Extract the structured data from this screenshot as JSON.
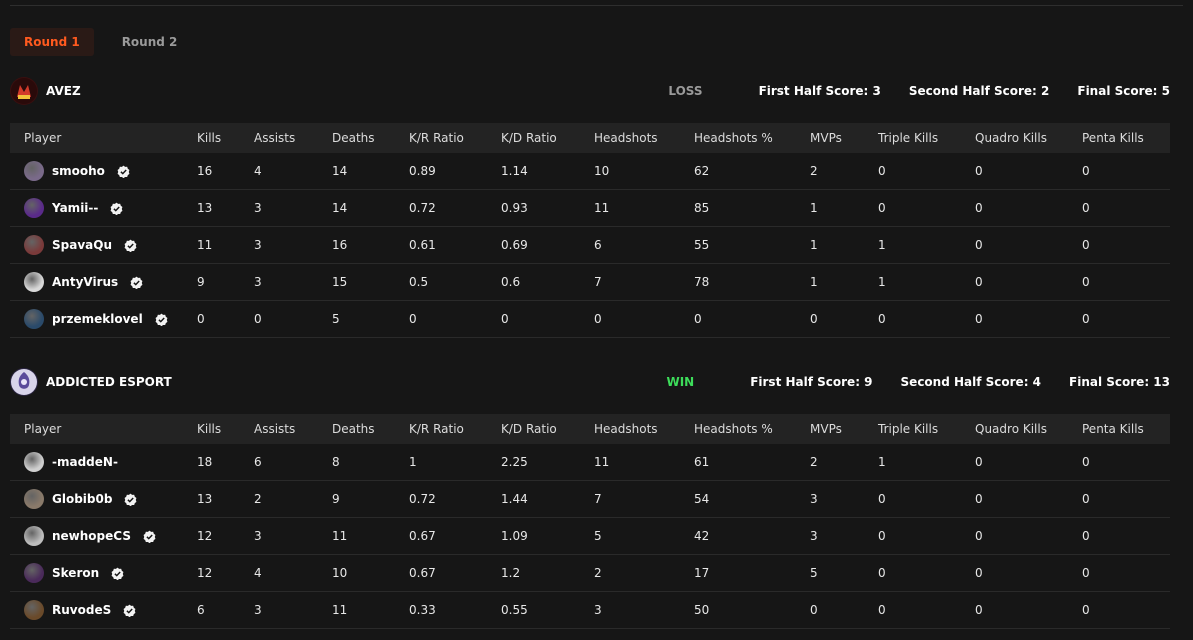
{
  "tabs": [
    {
      "label": "Round 1",
      "active": true
    },
    {
      "label": "Round 2",
      "active": false
    }
  ],
  "columns": [
    "Player",
    "Kills",
    "Assists",
    "Deaths",
    "K/R Ratio",
    "K/D Ratio",
    "Headshots",
    "Headshots %",
    "MVPs",
    "Triple Kills",
    "Quadro Kills",
    "Penta Kills"
  ],
  "teams": [
    {
      "name": "AVEZ",
      "result": "LOSS",
      "first_half": "First Half Score: 3",
      "second_half": "Second Half Score: 2",
      "final": "Final Score: 5",
      "accent": "#c0392b",
      "players": [
        {
          "name": "smooho",
          "verified": true,
          "avatar": "#7a6a8a",
          "stats": [
            "16",
            "4",
            "14",
            "0.89",
            "1.14",
            "10",
            "62",
            "2",
            "0",
            "0",
            "0"
          ]
        },
        {
          "name": "Yamii--",
          "verified": true,
          "avatar": "#5a2a8a",
          "stats": [
            "13",
            "3",
            "14",
            "0.72",
            "0.93",
            "11",
            "85",
            "1",
            "0",
            "0",
            "0"
          ]
        },
        {
          "name": "SpavaQu",
          "verified": true,
          "avatar": "#7a3a3a",
          "stats": [
            "11",
            "3",
            "16",
            "0.61",
            "0.69",
            "6",
            "55",
            "1",
            "1",
            "0",
            "0"
          ]
        },
        {
          "name": "AntyVirus",
          "verified": true,
          "avatar": "#d8d8d8",
          "stats": [
            "9",
            "3",
            "15",
            "0.5",
            "0.6",
            "7",
            "78",
            "1",
            "1",
            "0",
            "0"
          ]
        },
        {
          "name": "przemeklovel",
          "verified": true,
          "avatar": "#2a4a6a",
          "stats": [
            "0",
            "0",
            "5",
            "0",
            "0",
            "0",
            "0",
            "0",
            "0",
            "0",
            "0"
          ]
        }
      ]
    },
    {
      "name": "ADDICTED ESPORT",
      "result": "WIN",
      "first_half": "First Half Score: 9",
      "second_half": "Second Half Score: 4",
      "final": "Final Score: 13",
      "accent": "#6a5aa8",
      "players": [
        {
          "name": "-maddeN-",
          "verified": false,
          "avatar": "#cfcfcf",
          "stats": [
            "18",
            "6",
            "8",
            "1",
            "2.25",
            "11",
            "61",
            "2",
            "1",
            "0",
            "0"
          ]
        },
        {
          "name": "Globib0b",
          "verified": true,
          "avatar": "#8a7a6a",
          "stats": [
            "13",
            "2",
            "9",
            "0.72",
            "1.44",
            "7",
            "54",
            "3",
            "0",
            "0",
            "0"
          ]
        },
        {
          "name": "newhopeCS",
          "verified": true,
          "avatar": "#bdbdbd",
          "stats": [
            "12",
            "3",
            "11",
            "0.67",
            "1.09",
            "5",
            "42",
            "3",
            "0",
            "0",
            "0"
          ]
        },
        {
          "name": "Skeron",
          "verified": true,
          "avatar": "#4a2a5a",
          "stats": [
            "12",
            "4",
            "10",
            "0.67",
            "1.2",
            "2",
            "17",
            "5",
            "0",
            "0",
            "0"
          ]
        },
        {
          "name": "RuvodeS",
          "verified": true,
          "avatar": "#6a4a2a",
          "stats": [
            "6",
            "3",
            "11",
            "0.33",
            "0.55",
            "3",
            "50",
            "0",
            "0",
            "0",
            "0"
          ]
        }
      ]
    }
  ]
}
